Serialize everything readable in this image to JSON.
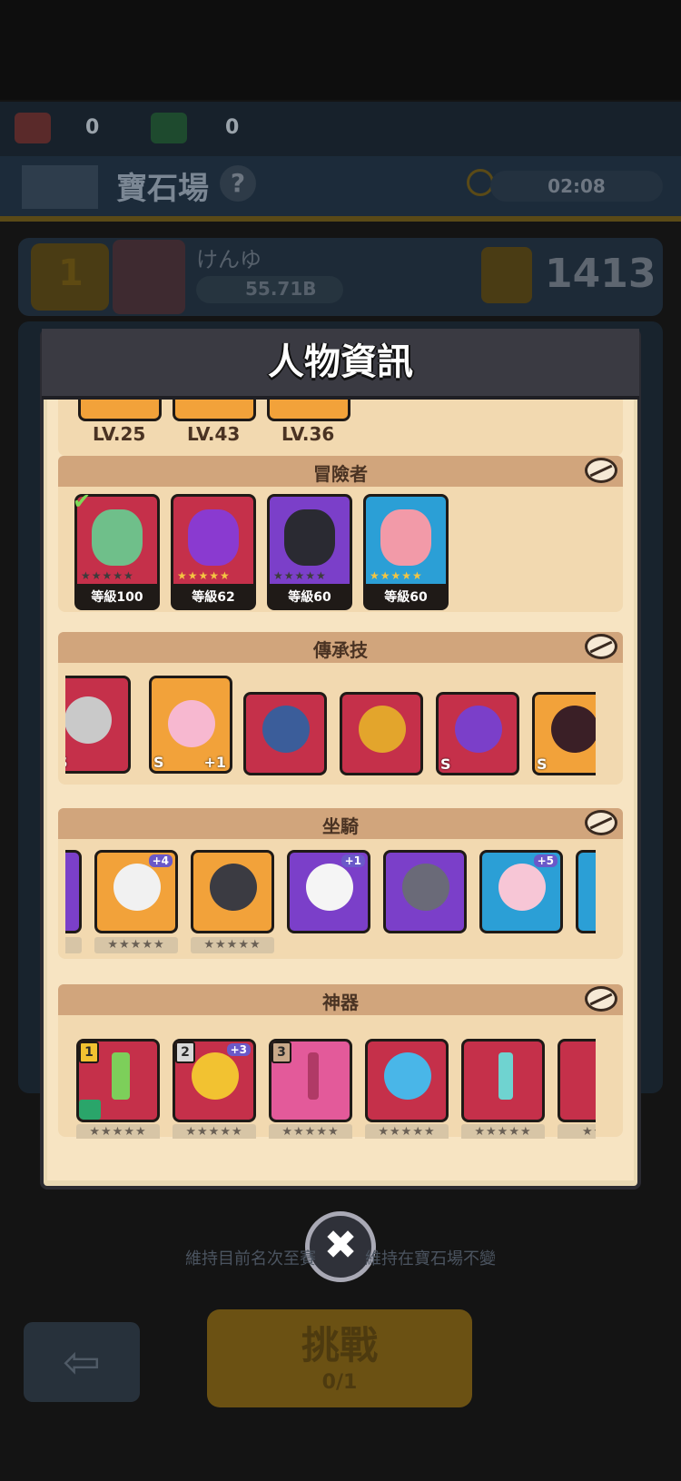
{
  "resources": {
    "ticket_count": "0",
    "gem_count": "0"
  },
  "arena": {
    "title": "寶石場",
    "help": "?",
    "timer": "02:08"
  },
  "player": {
    "rank": "1",
    "name": "けんゆ",
    "power": "55.71B",
    "score": "1413"
  },
  "dialog": {
    "title": "人物資訊",
    "pet_levels": [
      "LV.25",
      "LV.43",
      "LV.36"
    ],
    "adventurers": {
      "title": "冒險者",
      "items": [
        {
          "level": "等級100",
          "stars": "★★★★★",
          "color": "#c5304a"
        },
        {
          "level": "等級62",
          "stars": "★★★★★",
          "color": "#c5304a"
        },
        {
          "level": "等級60",
          "stars": "★★★★★",
          "color": "#7b3fc9"
        },
        {
          "level": "等級60",
          "stars": "★★★★★",
          "color": "#2b9fd6"
        }
      ]
    },
    "legacy_skills": {
      "title": "傳承技",
      "items": [
        {
          "badge": "S",
          "plus": "",
          "color": "#c5304a"
        },
        {
          "badge": "S",
          "plus": "+1",
          "color": "#f2a23a"
        },
        {
          "badge": "",
          "plus": "",
          "color": "#c5304a"
        },
        {
          "badge": "",
          "plus": "",
          "color": "#c5304a"
        },
        {
          "badge": "S",
          "plus": "",
          "color": "#c5304a"
        },
        {
          "badge": "S",
          "plus": "",
          "color": "#f2a23a"
        }
      ]
    },
    "mounts": {
      "title": "坐騎",
      "items": [
        {
          "plus": "",
          "stars": "★",
          "color": "#7b3fc9"
        },
        {
          "plus": "+4",
          "stars": "★★★★★",
          "color": "#f2a23a"
        },
        {
          "plus": "",
          "stars": "★★★★★",
          "color": "#f2a23a"
        },
        {
          "plus": "+1",
          "stars": "",
          "color": "#7b3fc9"
        },
        {
          "plus": "",
          "stars": "",
          "color": "#7b3fc9"
        },
        {
          "plus": "+5",
          "stars": "",
          "color": "#2b9fd6"
        },
        {
          "plus": "",
          "stars": "",
          "color": "#2b9fd6"
        }
      ]
    },
    "artifacts": {
      "title": "神器",
      "items": [
        {
          "slot": "1",
          "plus": "",
          "stars": "★★★★★",
          "color": "#c5304a"
        },
        {
          "slot": "2",
          "plus": "+3",
          "stars": "★★★★★",
          "color": "#c5304a"
        },
        {
          "slot": "3",
          "plus": "",
          "stars": "★★★★★",
          "color": "#e35a9a"
        },
        {
          "slot": "",
          "plus": "",
          "stars": "★★★★★",
          "color": "#c5304a"
        },
        {
          "slot": "",
          "plus": "",
          "stars": "★★★★★",
          "color": "#c5304a"
        },
        {
          "slot": "",
          "plus": "",
          "stars": "★★★",
          "color": "#c5304a"
        }
      ]
    },
    "close_icon": "✖"
  },
  "footer": {
    "message": "維持目前名次至賽　　　維持在寶石場不變",
    "back_icon": "⇦",
    "challenge_label": "挑戰",
    "challenge_tickets": "0/1"
  }
}
